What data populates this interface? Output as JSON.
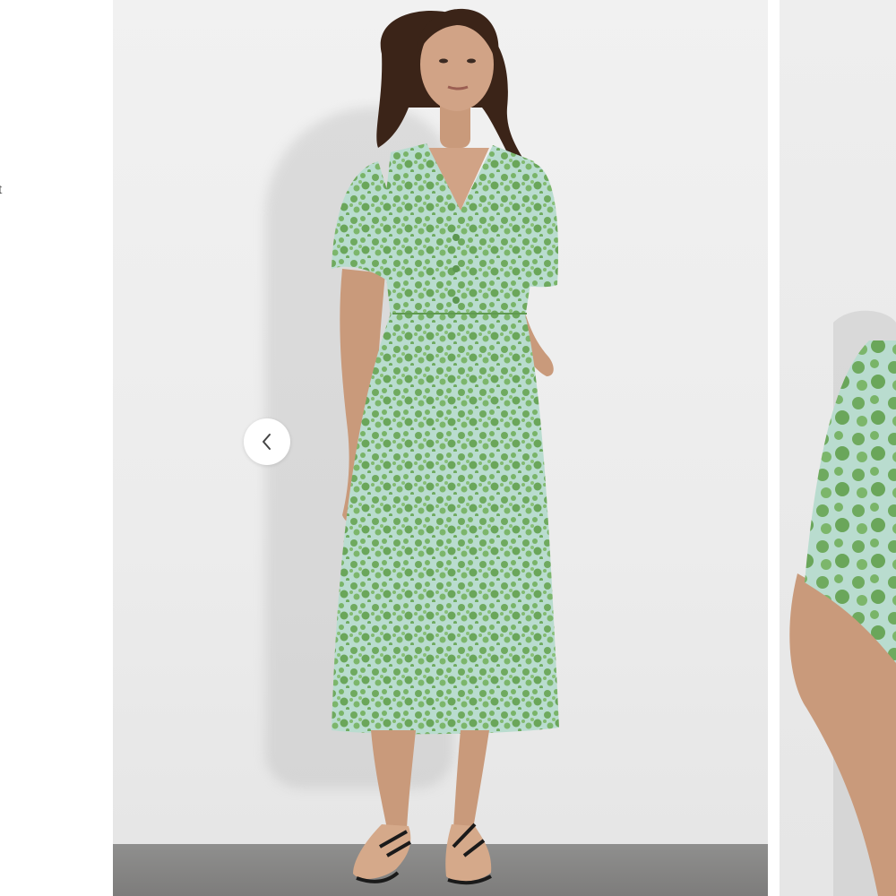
{
  "gallery": {
    "left_fragment_text": "t",
    "prev_button": {
      "icon": "chevron-left-icon",
      "label": "Previous image"
    }
  },
  "colors": {
    "dress_green": "#7bb36b",
    "dress_light": "#b9dccf",
    "floor": "#868584",
    "wall": "#eeeeee",
    "skin": "#c99a7b",
    "hair": "#3b2418"
  }
}
